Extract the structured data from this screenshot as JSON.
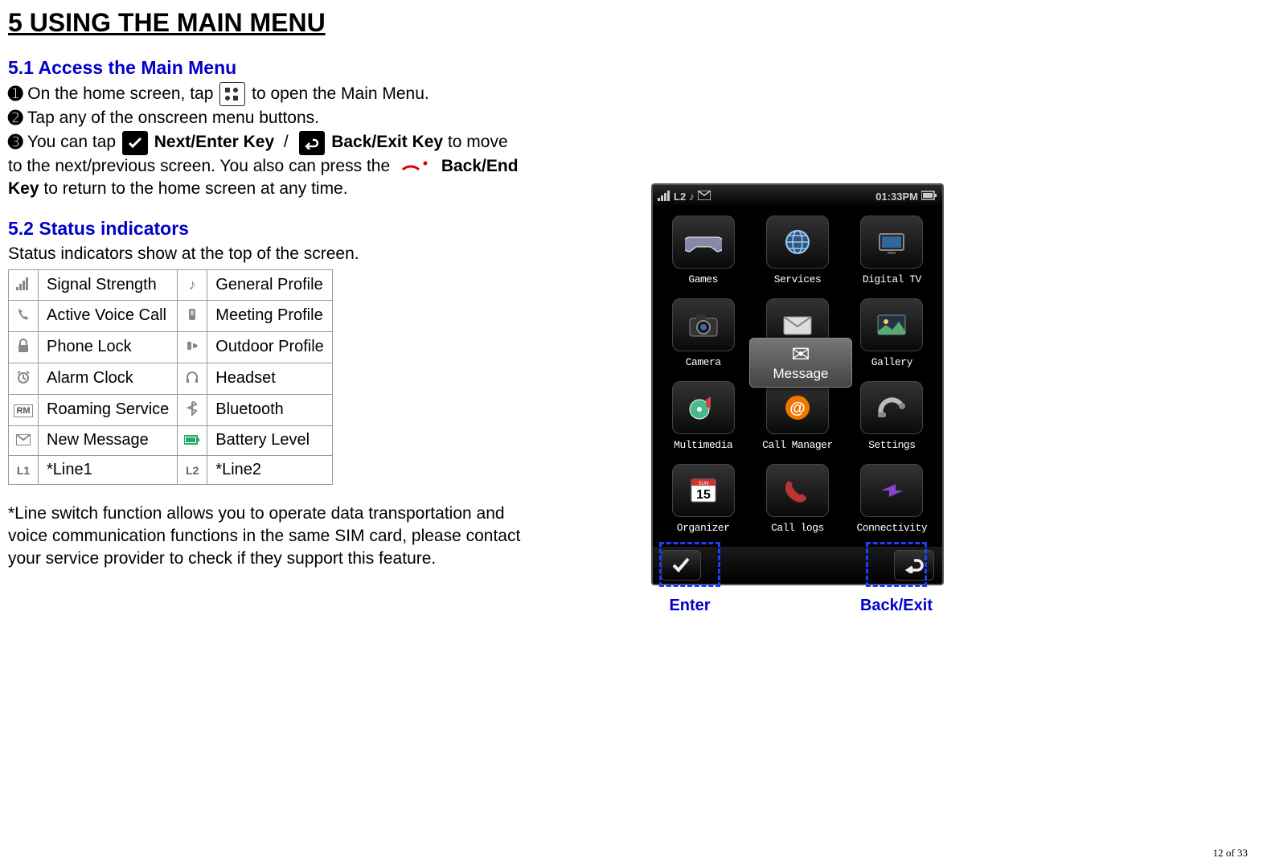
{
  "title": "5 USING THE MAIN MENU",
  "section1": {
    "heading": "5.1 Access the Main Menu",
    "step1_a": "On the home screen, tap",
    "step1_b": "to open the Main Menu.",
    "step2": "Tap any of the onscreen menu buttons.",
    "step3_a": "You can tap",
    "step3_next_label": "Next/Enter Key",
    "step3_slash": "/",
    "step3_back_label": "Back/Exit Key",
    "step3_b": "to move to the next/previous screen. You also can press the",
    "step3_endkey_label": "Back/End Key",
    "step3_c": "to return to the home screen at any time."
  },
  "section2": {
    "heading": "5.2 Status indicators",
    "intro": "Status indicators show at the top of the screen.",
    "rows": [
      {
        "l_icon": "signal",
        "l_label": "Signal Strength",
        "r_icon": "note",
        "r_label": "General Profile"
      },
      {
        "l_icon": "call",
        "l_label": "Active Voice Call",
        "r_icon": "meeting",
        "r_label": "Meeting Profile"
      },
      {
        "l_icon": "lock",
        "l_label": "Phone Lock",
        "r_icon": "outdoor",
        "r_label": "Outdoor Profile"
      },
      {
        "l_icon": "alarm",
        "l_label": "Alarm Clock",
        "r_icon": "headset",
        "r_label": "Headset"
      },
      {
        "l_icon": "roam",
        "l_label": "Roaming Service",
        "r_icon": "bt",
        "r_label": "Bluetooth"
      },
      {
        "l_icon": "msg",
        "l_label": "New Message",
        "r_icon": "batt",
        "r_label": "Battery Level"
      },
      {
        "l_icon": "l1",
        "l_label": "*Line1",
        "r_icon": "l2",
        "r_label": "*Line2"
      }
    ],
    "note": "*Line switch function allows you to operate data transportation and voice communication functions in the same SIM card, please contact your service provider to check if they support this feature."
  },
  "phone": {
    "status_left_text": "L2",
    "status_right_text": "01:33PM",
    "apps": [
      {
        "name": "Games"
      },
      {
        "name": "Services"
      },
      {
        "name": "Digital TV"
      },
      {
        "name": "Camera"
      },
      {
        "name": "Message"
      },
      {
        "name": "Gallery"
      },
      {
        "name": "Multimedia"
      },
      {
        "name": "Call Manager"
      },
      {
        "name": "Settings"
      },
      {
        "name": "Organizer"
      },
      {
        "name": "Call logs"
      },
      {
        "name": "Connectivity"
      }
    ],
    "popup_label": "Message"
  },
  "annotations": {
    "enter": "Enter",
    "back": "Back/Exit"
  },
  "pagenum": "12 of 33"
}
